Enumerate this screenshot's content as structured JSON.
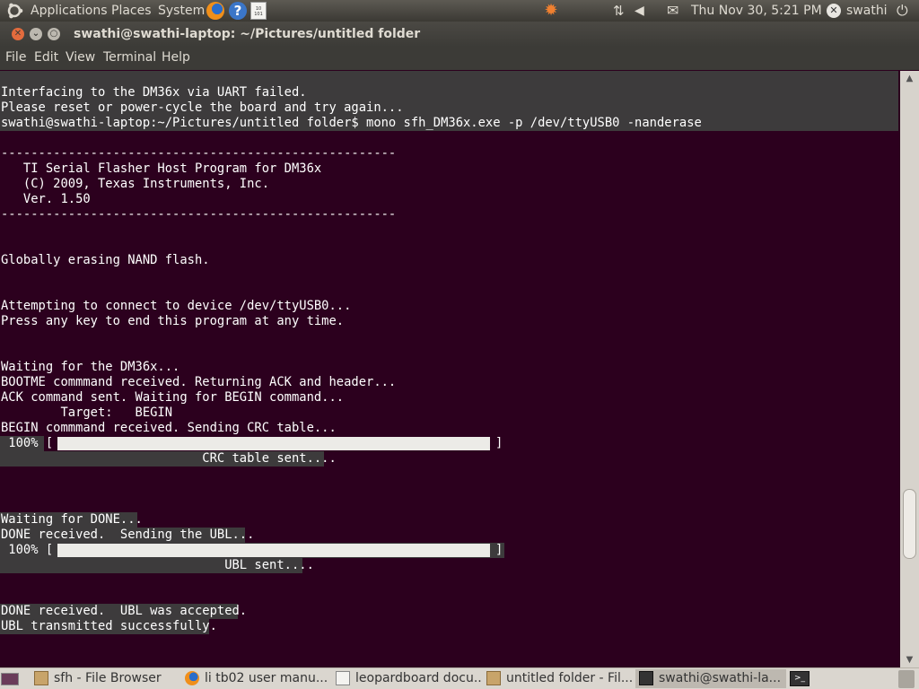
{
  "top_panel": {
    "applications": "Applications",
    "places": "Places",
    "system": "System",
    "clock": "Thu Nov 30,  5:21 PM",
    "user": "swathi"
  },
  "window": {
    "title": "swathi@swathi-laptop: ~/Pictures/untitled folder"
  },
  "menu": [
    "File",
    "Edit",
    "View",
    "Terminal",
    "Help"
  ],
  "terminal": {
    "lines": [
      "Interfacing to the DM36x via UART failed.",
      "Please reset or power-cycle the board and try again...",
      "swathi@swathi-laptop:~/Pictures/untitled folder$ mono sfh_DM36x.exe -p /dev/ttyUSB0 -nanderase",
      "-----------------------------------------------------",
      "   TI Serial Flasher Host Program for DM36x",
      "   (C) 2009, Texas Instruments, Inc.",
      "   Ver. 1.50",
      "-----------------------------------------------------",
      "Globally erasing NAND flash.",
      "Attempting to connect to device /dev/ttyUSB0...",
      "Press any key to end this program at any time.",
      "Waiting for the DM36x...",
      "BOOTME commmand received. Returning ACK and header...",
      "ACK command sent. Waiting for BEGIN command...",
      "        Target:   BEGIN",
      "BEGIN commmand received. Sending CRC table...",
      " 100% [",
      "]",
      "                           CRC table sent....",
      "Waiting for DONE...",
      "DONE received.  Sending the UBL...",
      " 100% [",
      "]",
      "                              UBL sent....",
      "DONE received.  UBL was accepted.",
      "UBL transmitted successfully."
    ],
    "crc_progress": 1.0,
    "ubl_progress": 1.0
  },
  "taskbar": {
    "tasks": [
      "sfh - File Browser",
      "li tb02 user manu...",
      "leopardboard docu...",
      "untitled folder - Fil...",
      "swathi@swathi-la..."
    ]
  }
}
